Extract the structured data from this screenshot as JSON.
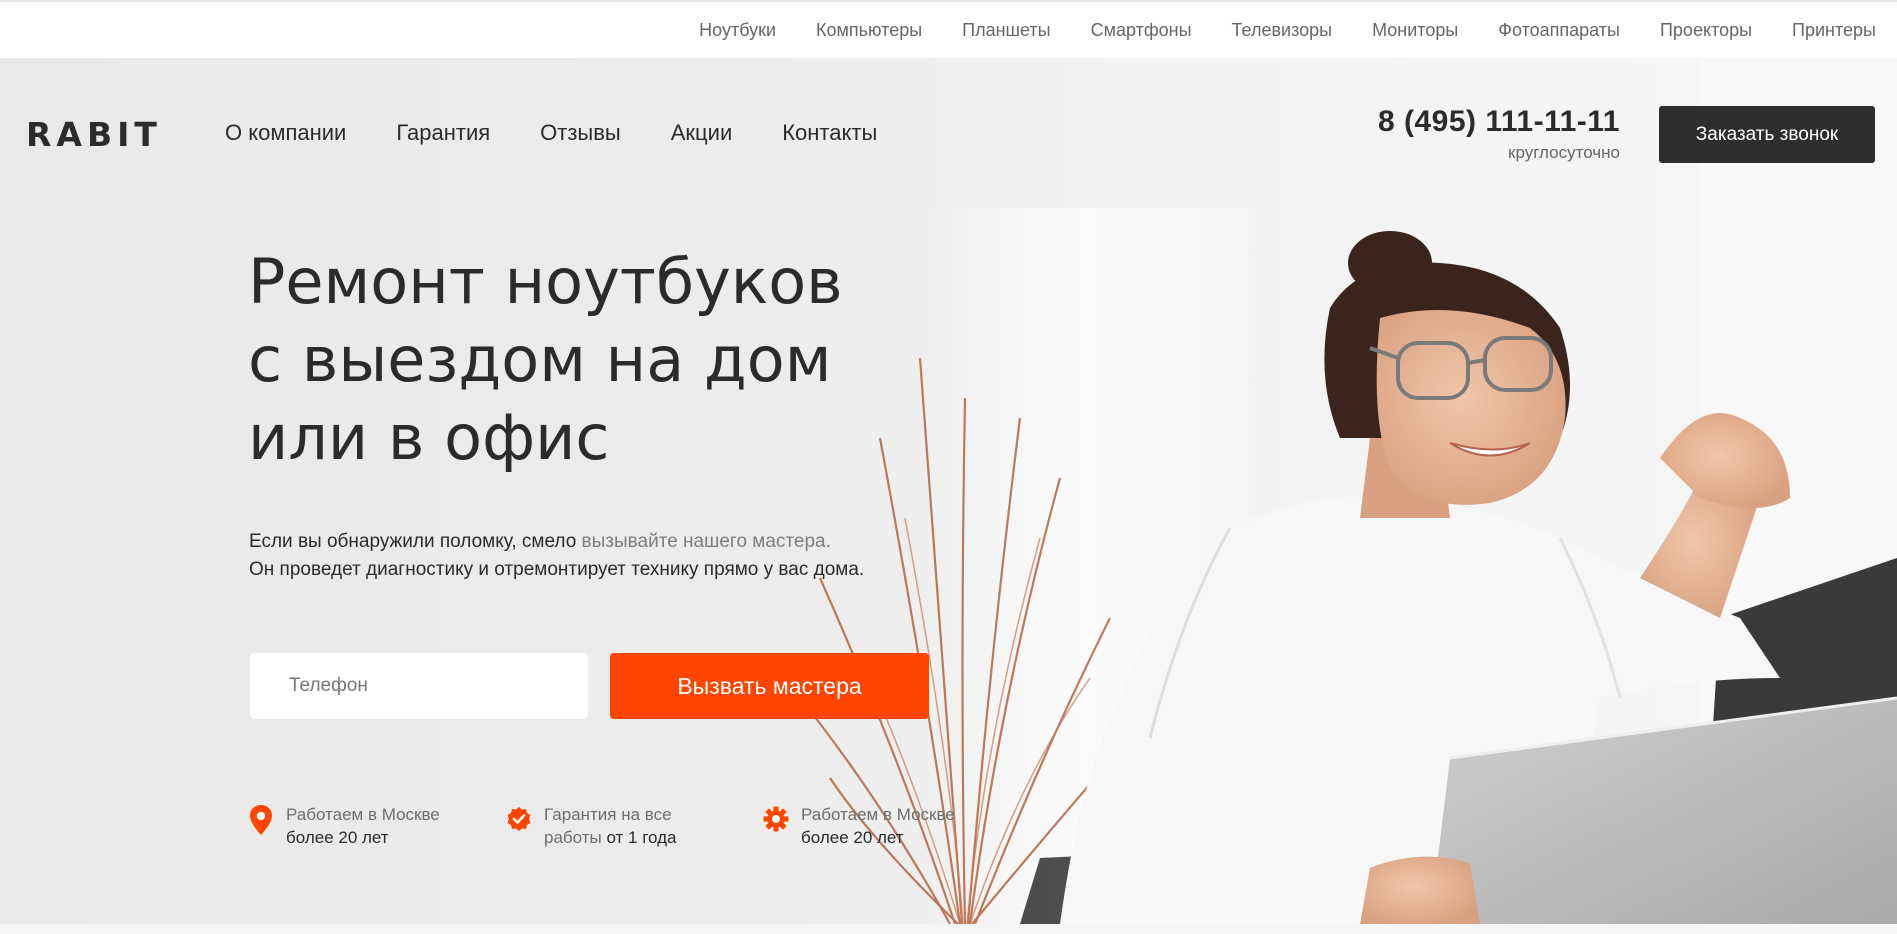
{
  "topbar": {
    "categories": [
      "Ноутбуки",
      "Компьютеры",
      "Планшеты",
      "Смартфоны",
      "Телевизоры",
      "Мониторы",
      "Фотоаппараты",
      "Проекторы",
      "Принтеры"
    ]
  },
  "header": {
    "logo": "RABIT",
    "nav": [
      "О компании",
      "Гарантия",
      "Отзывы",
      "Акции",
      "Контакты"
    ],
    "phone": "8 (495) 111-11-11",
    "phone_hours": "круглосуточно",
    "callback_label": "Заказать звонок"
  },
  "hero": {
    "headline": [
      "Ремонт ноутбуков",
      "с выездом на дом",
      "или в офис"
    ],
    "lead_line1_start": "Если вы обнаружили поломку, смело ",
    "lead_line1_link": "вызывайте нашего мастера.",
    "lead_line2": "Он проведет диагностику и отремонтирует технику прямо у вас дома."
  },
  "form": {
    "phone_placeholder": "Телефон",
    "submit_label": "Вызвать мастера"
  },
  "features": [
    {
      "icon": "location-pin-icon",
      "line1": "Работаем в Москве",
      "line2": "более 20 лет"
    },
    {
      "icon": "badge-check-icon",
      "line1": "Гарантия на все",
      "line2_muted": "работы",
      "line2_rest": " от 1 года"
    },
    {
      "icon": "gear-icon",
      "line1": "Работаем в Москве",
      "line2": "более 20 лет"
    }
  ],
  "colors": {
    "accent": "#ff4500",
    "dark": "#2e2e2e",
    "text": "#2b2b2b",
    "muted": "#777777",
    "hero_bg": "#ececec"
  }
}
